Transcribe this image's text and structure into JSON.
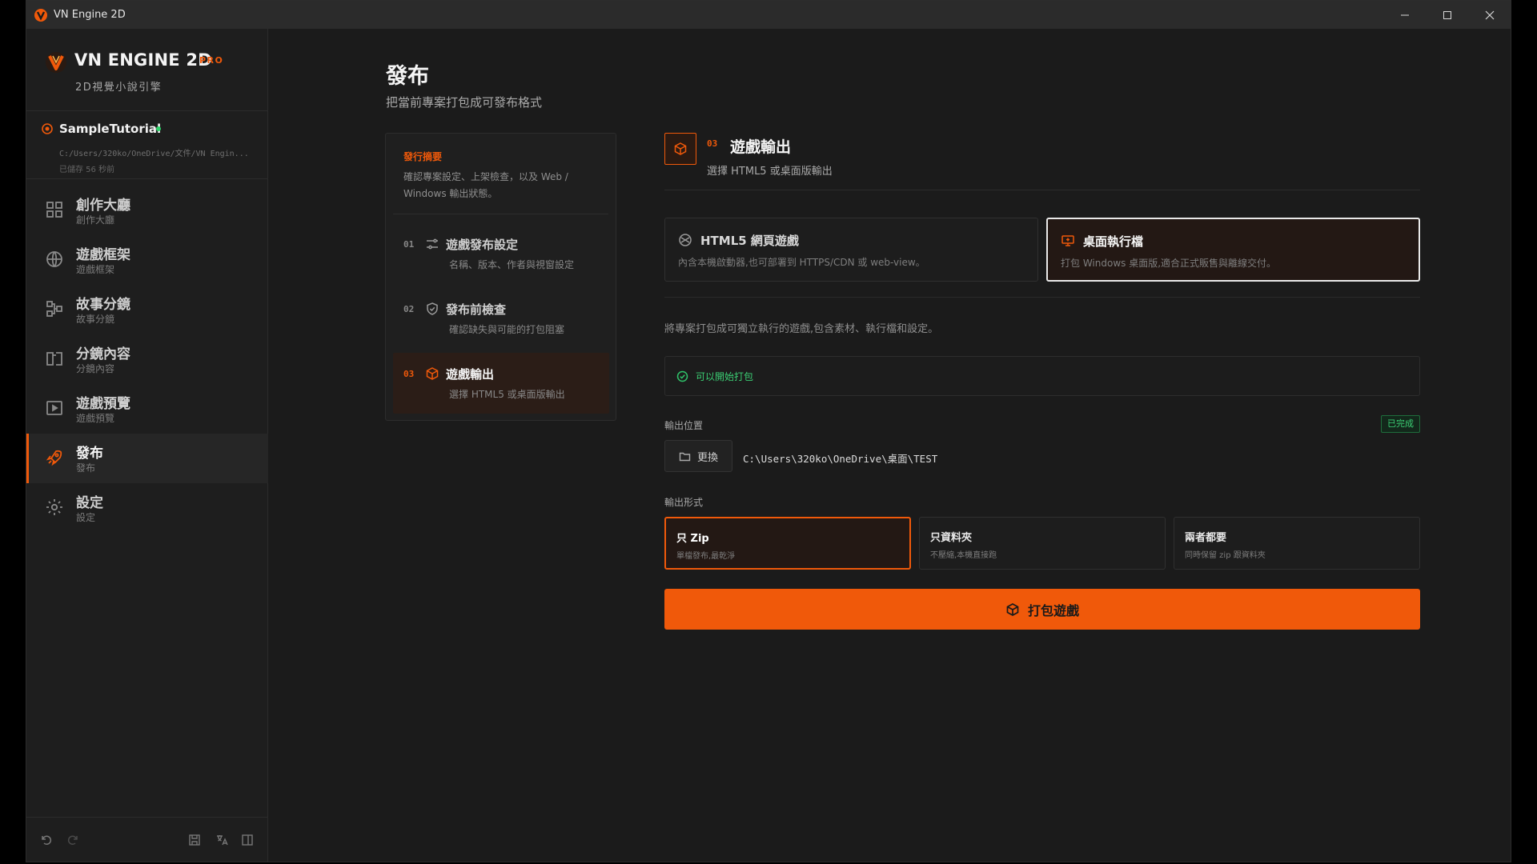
{
  "window": {
    "title": "VN Engine 2D"
  },
  "brand": {
    "name": "VN ENGINE 2D",
    "badge": "PRO",
    "subtitle": "2D視覺小說引擎"
  },
  "project": {
    "name": "SampleTutorial",
    "path": "C:/Users/320ko/OneDrive/文件/VN Engin...",
    "saved": "已儲存 56 秒前"
  },
  "nav": [
    {
      "label": "創作大廳",
      "sub": "創作大廳",
      "icon": "dashboard-icon"
    },
    {
      "label": "遊戲框架",
      "sub": "遊戲框架",
      "icon": "globe-icon"
    },
    {
      "label": "故事分鏡",
      "sub": "故事分鏡",
      "icon": "flow-icon"
    },
    {
      "label": "分鏡內容",
      "sub": "分鏡內容",
      "icon": "book-icon"
    },
    {
      "label": "遊戲預覽",
      "sub": "遊戲預覽",
      "icon": "play-icon"
    },
    {
      "label": "發布",
      "sub": "發布",
      "icon": "rocket-icon",
      "active": true
    },
    {
      "label": "設定",
      "sub": "設定",
      "icon": "gear-icon"
    }
  ],
  "page": {
    "title": "發布",
    "subtitle": "把當前專案打包成可發布格式"
  },
  "steps": {
    "summary_title": "發行摘要",
    "summary_desc": "確認專案設定、上架檢查，以及 Web / Windows 輸出狀態。",
    "items": [
      {
        "num": "01",
        "title": "遊戲發布設定",
        "desc": "名稱、版本、作者與視窗設定"
      },
      {
        "num": "02",
        "title": "發布前檢查",
        "desc": "確認缺失與可能的打包阻塞"
      },
      {
        "num": "03",
        "title": "遊戲輸出",
        "desc": "選擇 HTML5 或桌面版輸出"
      }
    ]
  },
  "section": {
    "num": "03",
    "title": "遊戲輸出",
    "subtitle": "選擇 HTML5 或桌面版輸出"
  },
  "targets": [
    {
      "title": "HTML5 網頁遊戲",
      "desc": "內含本機啟動器,也可部署到 HTTPS/CDN 或 web-view。",
      "icon": "web-icon"
    },
    {
      "title": "桌面執行檔",
      "desc": "打包 Windows 桌面版,適合正式販售與離線交付。",
      "icon": "desktop-icon"
    }
  ],
  "description": "將專案打包成可獨立執行的遊戲,包含素材、執行檔和設定。",
  "ready_text": "可以開始打包",
  "output": {
    "label": "輸出位置",
    "badge": "已完成",
    "change": "更換",
    "path": "C:\\Users\\320ko\\OneDrive\\桌面\\TEST"
  },
  "format": {
    "label": "輸出形式",
    "options": [
      {
        "title": "只 Zip",
        "desc": "單檔發布,最乾淨"
      },
      {
        "title": "只資料夾",
        "desc": "不壓縮,本機直接跑"
      },
      {
        "title": "兩者都要",
        "desc": "同時保留 zip 跟資料夾"
      }
    ]
  },
  "pack_button": "打包遊戲",
  "colors": {
    "accent": "#f0590a",
    "success": "#3bcf74",
    "bg": "#1b1b1b"
  }
}
